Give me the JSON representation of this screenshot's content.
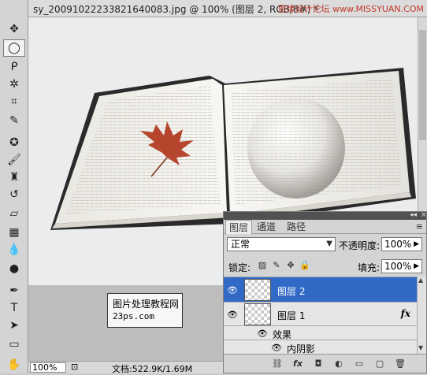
{
  "document": {
    "title": "sy_20091022233821640083.jpg @ 100% (图层 2, RGB/8#) *",
    "close_glyph": "×",
    "watermark": "思缘设计论坛 www.MISSYUAN.COM",
    "zoom": "100%",
    "status_info": "文档:522.9K/1.69M"
  },
  "stamp": {
    "line1": "图片处理教程网",
    "line2": "23ps.com"
  },
  "tools": [
    "move",
    "ellipse-marquee",
    "lasso",
    "magic-wand",
    "crop",
    "eyedropper",
    "healing",
    "brush",
    "clone-stamp",
    "history-brush",
    "eraser",
    "gradient",
    "blur",
    "dodge",
    "pen",
    "type",
    "path-select",
    "rectangle",
    "hand"
  ],
  "layers_panel": {
    "tabs": [
      "图层",
      "通道",
      "路径"
    ],
    "active_tab": 0,
    "menu_glyph": "≡",
    "blend_mode": "正常",
    "opacity_label": "不透明度:",
    "opacity_value": "100%",
    "lock_label": "锁定:",
    "fill_label": "填充:",
    "fill_value": "100%",
    "layers": [
      {
        "name": "图层 2",
        "selected": true
      },
      {
        "name": "图层 1",
        "fx": "fx"
      }
    ],
    "effects_label": "效果",
    "inner_shadow_label": "内阴影"
  },
  "colors": {
    "selection": "#3169c6",
    "panel": "#d4d4d4"
  }
}
